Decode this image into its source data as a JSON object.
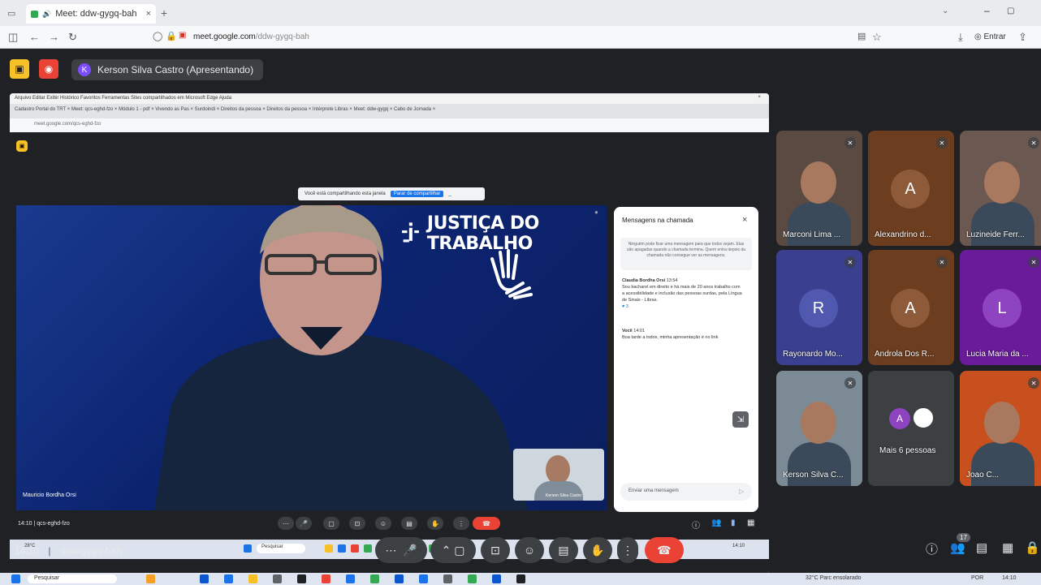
{
  "browser": {
    "tab_title": "Meet: ddw-gygq-bah",
    "url_host": "meet.google.com",
    "url_path": "/ddw-gygq-bah",
    "signin_label": "Entrar"
  },
  "meet": {
    "presenter_label": "Kerson Silva Castro (Apresentando)",
    "presenter_initial": "K",
    "time": "14:10",
    "meeting_code": "ddw-gygq-bah",
    "participant_count_badge": "17"
  },
  "shared_screen": {
    "menu_items": [
      "Arquivo",
      "Editar",
      "Exibir",
      "Histórico",
      "Favoritos",
      "Ferramentas",
      "Sites compartilhados em Microsoft Edge",
      "Ajuda"
    ],
    "tabs_text": "Cadastro Portal do TRT ×   Meet: qcs-eghd-fzo ×   Módulo 1 - pdf ×   Vivendo as Pas ×   Surdoindi ×   Direitos da pessoa ×   Direitos da pessoa ×   Intérprete Libras ×   Meet: ddw-gygq ×   Cabo de Jornada ×",
    "url_text": "meet.google.com/qcs-eghd-fzo",
    "share_banner_text": "Você está compartilhando esta janela",
    "share_banner_button": "Parar de compartilhar",
    "main_video_name": "Mauricio Bordha Orsi",
    "brand_text": "JUSTIÇA DO TRABALHO",
    "self_preview_name": "Kerson Silva Castro",
    "chat": {
      "title": "Mensagens na chamada",
      "note": "Ninguém pode fixar uma mensagem para que todos vejam. Elas são apagadas quando a chamada termina. Quem entra depois da chamada não consegue ver as mensagens.",
      "msg1_author": "Claudia Bordha Orsi",
      "msg1_time": "13:54",
      "msg1_body": "Sou bacharel em direito e há mais de 20 anos trabalho com a acessibilidade e inclusão das pessoas surdas, pela Língua de Sinais - Libras.",
      "msg1_reactions": "3",
      "msg2_author": "Você",
      "msg2_time": "14:01",
      "msg2_body": "Boa tarde a todos, minha apresentação é no link",
      "input_placeholder": "Enviar uma mensagem"
    },
    "inner_time": "14:10",
    "inner_code": "qcs-eghd-fzo",
    "inner_taskbar_weather": "28°C",
    "inner_taskbar_search": "Pesquisar",
    "inner_taskbar_time": "14:10"
  },
  "participants": [
    {
      "name": "Marconi Lima ...",
      "type": "video",
      "bg": "#5a4a42"
    },
    {
      "name": "Alexandrino d...",
      "type": "avatar",
      "initial": "A",
      "bg": "#6d3d1f",
      "avatar_bg": "#8d5a3a"
    },
    {
      "name": "Luzineide Ferr...",
      "type": "video",
      "bg": "#6b5850"
    },
    {
      "name": "Rayonardo Mo...",
      "type": "avatar",
      "initial": "R",
      "bg": "#3a3f8f",
      "avatar_bg": "#5058b0"
    },
    {
      "name": "Androla Dos R...",
      "type": "avatar",
      "initial": "A",
      "bg": "#6d3d1f",
      "avatar_bg": "#8d5a3a"
    },
    {
      "name": "Lucia Maria da ...",
      "type": "avatar",
      "initial": "L",
      "bg": "#6a1b9a",
      "avatar_bg": "#8e44c0"
    },
    {
      "name": "Kerson Silva C...",
      "type": "video",
      "bg": "#7b8a94"
    },
    {
      "name": "Mais 6 pessoas",
      "type": "more",
      "initial": "A",
      "bg": "#3c4043"
    },
    {
      "name": "Joao C...",
      "type": "video",
      "bg": "#c8501e"
    }
  ],
  "taskbar": {
    "search_placeholder": "Pesquisar",
    "weather": "32°C Parc ensolarado",
    "lang": "POR",
    "time": "14:10"
  },
  "colors": {
    "meet_bg": "#202124",
    "end_call_red": "#ea4335",
    "chip_bg": "#3c4043"
  }
}
